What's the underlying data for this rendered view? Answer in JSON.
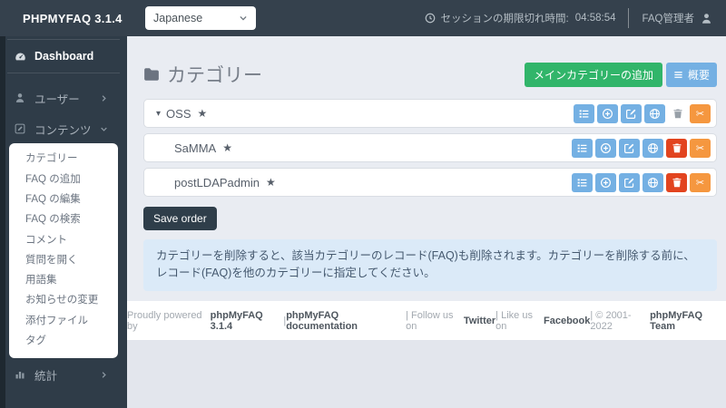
{
  "topbar": {
    "brand": "PHPMYFAQ 3.1.4",
    "language": {
      "selected": "Japanese"
    },
    "session": {
      "label": "セッションの期限切れ時間:",
      "time": "04:58:54"
    },
    "user_label": "FAQ管理者"
  },
  "sidebar": {
    "dashboard_label": "Dashboard",
    "users_label": "ユーザー",
    "content_label": "コンテンツ",
    "stats_label": "統計",
    "content_submenu": [
      "カテゴリー",
      "FAQ の追加",
      "FAQ の編集",
      "FAQ の検索",
      "コメント",
      "質問を開く",
      "用語集",
      "お知らせの変更",
      "添付ファイル",
      "タグ"
    ]
  },
  "main": {
    "title": "カテゴリー",
    "buttons": {
      "add_main_category": "メインカテゴリーの追加",
      "overview": "概要"
    },
    "categories": [
      {
        "name": "OSS"
      },
      {
        "name": "SaMMA"
      },
      {
        "name": "postLDAPadmin"
      }
    ],
    "save_order_label": "Save order",
    "info_alert": "カテゴリーを削除すると、該当カテゴリーのレコード(FAQ)も削除されます。カテゴリーを削除する前に、レコード(FAQ)を他のカテゴリーに指定してください。"
  },
  "footer": {
    "parts": [
      {
        "text": "Proudly powered by "
      },
      {
        "text": "phpMyFAQ 3.1.4",
        "link": true
      },
      {
        "text": " | "
      },
      {
        "text": "phpMyFAQ documentation",
        "link": true
      },
      {
        "text": " | Follow us on "
      },
      {
        "text": "Twitter",
        "link": true
      },
      {
        "text": " | Like us on "
      },
      {
        "text": "Facebook",
        "link": true
      },
      {
        "text": " | © 2001-2022 "
      },
      {
        "text": "phpMyFAQ Team",
        "link": true
      }
    ]
  },
  "icons": {
    "star": "★",
    "scissors": "✂",
    "caret_down": "▾"
  },
  "colors": {
    "topbar_bg": "#35414d",
    "sidebar_bg": "#2f3c48",
    "content_bg": "#e9ecf2",
    "accent_green": "#31b56a",
    "accent_blue": "#74b0e3",
    "accent_red": "#e2441f",
    "accent_orange": "#f5973f",
    "alert_bg": "#dbeaf8",
    "dark_button": "#2f3e4a"
  }
}
